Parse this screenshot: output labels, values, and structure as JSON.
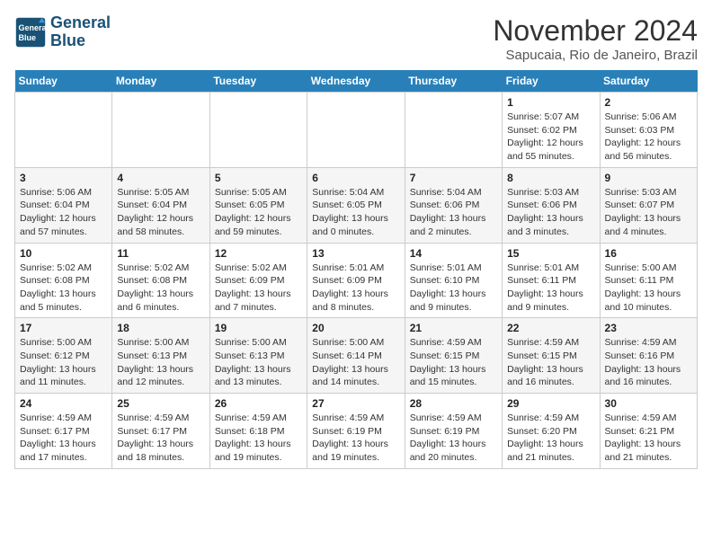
{
  "logo": {
    "line1": "General",
    "line2": "Blue"
  },
  "title": "November 2024",
  "subtitle": "Sapucaia, Rio de Janeiro, Brazil",
  "weekdays": [
    "Sunday",
    "Monday",
    "Tuesday",
    "Wednesday",
    "Thursday",
    "Friday",
    "Saturday"
  ],
  "weeks": [
    [
      {
        "day": "",
        "detail": ""
      },
      {
        "day": "",
        "detail": ""
      },
      {
        "day": "",
        "detail": ""
      },
      {
        "day": "",
        "detail": ""
      },
      {
        "day": "",
        "detail": ""
      },
      {
        "day": "1",
        "detail": "Sunrise: 5:07 AM\nSunset: 6:02 PM\nDaylight: 12 hours\nand 55 minutes."
      },
      {
        "day": "2",
        "detail": "Sunrise: 5:06 AM\nSunset: 6:03 PM\nDaylight: 12 hours\nand 56 minutes."
      }
    ],
    [
      {
        "day": "3",
        "detail": "Sunrise: 5:06 AM\nSunset: 6:04 PM\nDaylight: 12 hours\nand 57 minutes."
      },
      {
        "day": "4",
        "detail": "Sunrise: 5:05 AM\nSunset: 6:04 PM\nDaylight: 12 hours\nand 58 minutes."
      },
      {
        "day": "5",
        "detail": "Sunrise: 5:05 AM\nSunset: 6:05 PM\nDaylight: 12 hours\nand 59 minutes."
      },
      {
        "day": "6",
        "detail": "Sunrise: 5:04 AM\nSunset: 6:05 PM\nDaylight: 13 hours\nand 0 minutes."
      },
      {
        "day": "7",
        "detail": "Sunrise: 5:04 AM\nSunset: 6:06 PM\nDaylight: 13 hours\nand 2 minutes."
      },
      {
        "day": "8",
        "detail": "Sunrise: 5:03 AM\nSunset: 6:06 PM\nDaylight: 13 hours\nand 3 minutes."
      },
      {
        "day": "9",
        "detail": "Sunrise: 5:03 AM\nSunset: 6:07 PM\nDaylight: 13 hours\nand 4 minutes."
      }
    ],
    [
      {
        "day": "10",
        "detail": "Sunrise: 5:02 AM\nSunset: 6:08 PM\nDaylight: 13 hours\nand 5 minutes."
      },
      {
        "day": "11",
        "detail": "Sunrise: 5:02 AM\nSunset: 6:08 PM\nDaylight: 13 hours\nand 6 minutes."
      },
      {
        "day": "12",
        "detail": "Sunrise: 5:02 AM\nSunset: 6:09 PM\nDaylight: 13 hours\nand 7 minutes."
      },
      {
        "day": "13",
        "detail": "Sunrise: 5:01 AM\nSunset: 6:09 PM\nDaylight: 13 hours\nand 8 minutes."
      },
      {
        "day": "14",
        "detail": "Sunrise: 5:01 AM\nSunset: 6:10 PM\nDaylight: 13 hours\nand 9 minutes."
      },
      {
        "day": "15",
        "detail": "Sunrise: 5:01 AM\nSunset: 6:11 PM\nDaylight: 13 hours\nand 9 minutes."
      },
      {
        "day": "16",
        "detail": "Sunrise: 5:00 AM\nSunset: 6:11 PM\nDaylight: 13 hours\nand 10 minutes."
      }
    ],
    [
      {
        "day": "17",
        "detail": "Sunrise: 5:00 AM\nSunset: 6:12 PM\nDaylight: 13 hours\nand 11 minutes."
      },
      {
        "day": "18",
        "detail": "Sunrise: 5:00 AM\nSunset: 6:13 PM\nDaylight: 13 hours\nand 12 minutes."
      },
      {
        "day": "19",
        "detail": "Sunrise: 5:00 AM\nSunset: 6:13 PM\nDaylight: 13 hours\nand 13 minutes."
      },
      {
        "day": "20",
        "detail": "Sunrise: 5:00 AM\nSunset: 6:14 PM\nDaylight: 13 hours\nand 14 minutes."
      },
      {
        "day": "21",
        "detail": "Sunrise: 4:59 AM\nSunset: 6:15 PM\nDaylight: 13 hours\nand 15 minutes."
      },
      {
        "day": "22",
        "detail": "Sunrise: 4:59 AM\nSunset: 6:15 PM\nDaylight: 13 hours\nand 16 minutes."
      },
      {
        "day": "23",
        "detail": "Sunrise: 4:59 AM\nSunset: 6:16 PM\nDaylight: 13 hours\nand 16 minutes."
      }
    ],
    [
      {
        "day": "24",
        "detail": "Sunrise: 4:59 AM\nSunset: 6:17 PM\nDaylight: 13 hours\nand 17 minutes."
      },
      {
        "day": "25",
        "detail": "Sunrise: 4:59 AM\nSunset: 6:17 PM\nDaylight: 13 hours\nand 18 minutes."
      },
      {
        "day": "26",
        "detail": "Sunrise: 4:59 AM\nSunset: 6:18 PM\nDaylight: 13 hours\nand 19 minutes."
      },
      {
        "day": "27",
        "detail": "Sunrise: 4:59 AM\nSunset: 6:19 PM\nDaylight: 13 hours\nand 19 minutes."
      },
      {
        "day": "28",
        "detail": "Sunrise: 4:59 AM\nSunset: 6:19 PM\nDaylight: 13 hours\nand 20 minutes."
      },
      {
        "day": "29",
        "detail": "Sunrise: 4:59 AM\nSunset: 6:20 PM\nDaylight: 13 hours\nand 21 minutes."
      },
      {
        "day": "30",
        "detail": "Sunrise: 4:59 AM\nSunset: 6:21 PM\nDaylight: 13 hours\nand 21 minutes."
      }
    ]
  ]
}
